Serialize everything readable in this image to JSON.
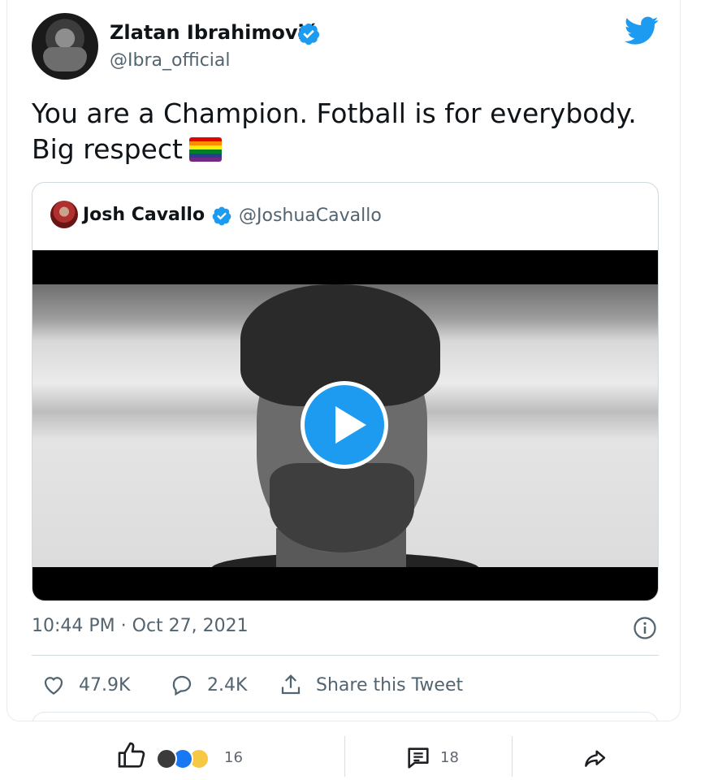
{
  "tweet": {
    "author_name": "Zlatan Ibrahimović",
    "author_handle": "@Ibra_official",
    "text": "You are a Champion. Fotball is for everybody. Big respect",
    "emoji": "rainbow-flag",
    "timestamp": "10:44 PM · Oct 27, 2021",
    "quoted": {
      "author_name": "Josh Cavallo",
      "author_handle": "@JoshuaCavallo"
    },
    "actions": {
      "likes": "47.9K",
      "replies": "2.4K",
      "share_label": "Share this Tweet"
    }
  },
  "social_bar": {
    "reaction_count": "16",
    "comment_count": "18"
  },
  "colors": {
    "twitter_blue": "#1d9bf0",
    "facebook_blue": "#1877f2",
    "text_primary": "#0f1419",
    "text_secondary": "#536471"
  },
  "icons": [
    "twitter-bird-icon",
    "verified-badge-icon",
    "play-icon",
    "info-icon",
    "heart-icon",
    "reply-bubble-icon",
    "share-upload-icon",
    "thumbs-up-icon",
    "comment-icon",
    "share-arrow-icon"
  ]
}
